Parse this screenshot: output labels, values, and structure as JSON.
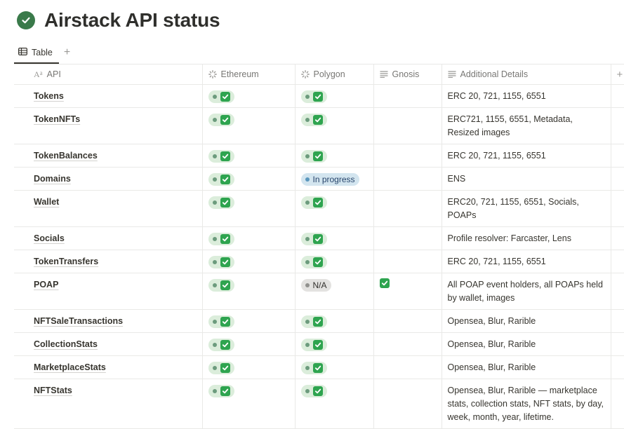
{
  "page": {
    "title": "Airstack API status",
    "title_icon": "check-circle-icon"
  },
  "views": {
    "tabs": [
      {
        "label": "Table",
        "icon": "table-icon"
      }
    ],
    "add_label": "+"
  },
  "table": {
    "columns": [
      {
        "label": "API",
        "icon": "title-aa-icon"
      },
      {
        "label": "Ethereum",
        "icon": "status-icon"
      },
      {
        "label": "Polygon",
        "icon": "status-icon"
      },
      {
        "label": "Gnosis",
        "icon": "text-lines-icon"
      },
      {
        "label": "Additional Details",
        "icon": "text-lines-icon"
      }
    ],
    "add_column_label": "+",
    "rows": [
      {
        "api": "Tokens",
        "ethereum": "done",
        "polygon": "done",
        "gnosis": "",
        "details": "ERC 20, 721, 1155, 6551"
      },
      {
        "api": "TokenNFTs",
        "ethereum": "done",
        "polygon": "done",
        "gnosis": "",
        "details": "ERC721, 1155, 6551, Metadata, Resized images"
      },
      {
        "api": "TokenBalances",
        "ethereum": "done",
        "polygon": "done",
        "gnosis": "",
        "details": "ERC 20, 721, 1155, 6551"
      },
      {
        "api": "Domains",
        "ethereum": "done",
        "polygon": "In progress",
        "gnosis": "",
        "details": "ENS"
      },
      {
        "api": "Wallet",
        "ethereum": "done",
        "polygon": "done",
        "gnosis": "",
        "details": "ERC20, 721, 1155, 6551, Socials, POAPs"
      },
      {
        "api": "Socials",
        "ethereum": "done",
        "polygon": "done",
        "gnosis": "",
        "details": "Profile resolver: Farcaster, Lens"
      },
      {
        "api": "TokenTransfers",
        "ethereum": "done",
        "polygon": "done",
        "gnosis": "",
        "details": "ERC 20, 721, 1155, 6551"
      },
      {
        "api": "POAP",
        "ethereum": "done",
        "polygon": "N/A",
        "gnosis": "done",
        "details": "All POAP event holders, all POAPs held by wallet, images"
      },
      {
        "api": "NFTSaleTransactions",
        "ethereum": "done",
        "polygon": "done",
        "gnosis": "",
        "details": "Opensea, Blur, Rarible"
      },
      {
        "api": "CollectionStats",
        "ethereum": "done",
        "polygon": "done",
        "gnosis": "",
        "details": "Opensea, Blur, Rarible"
      },
      {
        "api": "MarketplaceStats",
        "ethereum": "done",
        "polygon": "done",
        "gnosis": "",
        "details": "Opensea, Blur, Rarible"
      },
      {
        "api": "NFTStats",
        "ethereum": "done",
        "polygon": "done",
        "gnosis": "",
        "details": "Opensea, Blur, Rarible — marketplace stats, collection stats, NFT stats, by day, week, month, year, lifetime."
      }
    ]
  },
  "colors": {
    "done_pill": "#dbeddb",
    "done_dot": "#6c9b7d",
    "check": "#2ea44f",
    "progress_pill": "#d3e5ef",
    "na_pill": "#e3e2e0"
  }
}
